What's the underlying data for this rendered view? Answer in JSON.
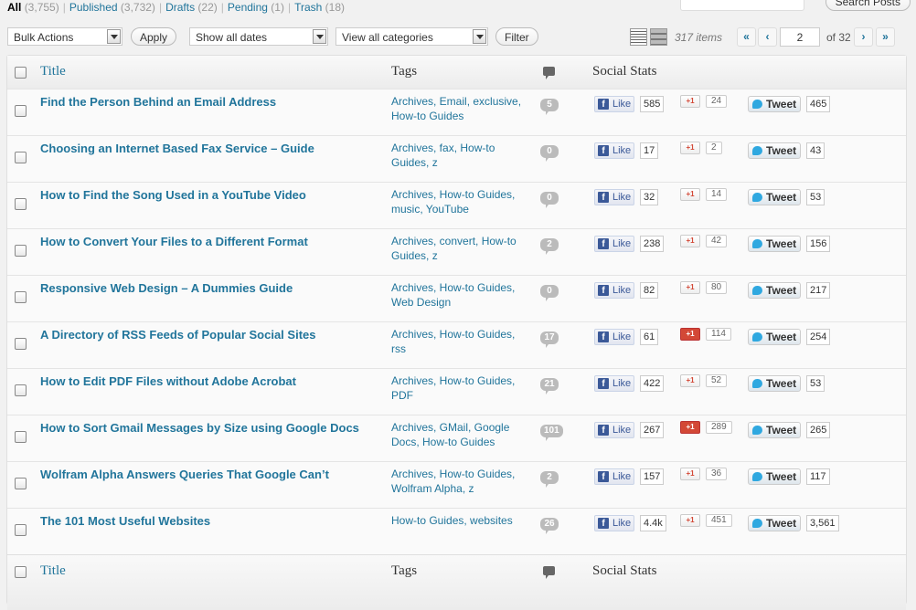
{
  "status_links": [
    {
      "label": "All",
      "count": "(3,755)",
      "current": true
    },
    {
      "label": "Published",
      "count": "(3,732)",
      "current": false
    },
    {
      "label": "Drafts",
      "count": "(22)",
      "current": false
    },
    {
      "label": "Pending",
      "count": "(1)",
      "current": false
    },
    {
      "label": "Trash",
      "count": "(18)",
      "current": false
    }
  ],
  "search_button": "Search Posts",
  "filters": {
    "bulk_actions": "Bulk Actions",
    "apply": "Apply",
    "dates": "Show all dates",
    "categories": "View all categories",
    "filter": "Filter"
  },
  "pagination": {
    "items": "317 items",
    "first": "«",
    "prev": "‹",
    "current_page": "2",
    "of_total": "of 32",
    "next": "›",
    "last": "»"
  },
  "columns": {
    "title": "Title",
    "tags": "Tags",
    "social": "Social Stats"
  },
  "posts": [
    {
      "title": "Find the Person Behind an Email Address",
      "tags": "Archives, Email, exclusive, How-to Guides",
      "comments": "5",
      "fb": "585",
      "gplus": "24",
      "gplus_on": false,
      "tweets": "465"
    },
    {
      "title": "Choosing an Internet Based Fax Service – Guide",
      "tags": "Archives, fax, How-to Guides, z",
      "comments": "0",
      "fb": "17",
      "gplus": "2",
      "gplus_on": false,
      "tweets": "43"
    },
    {
      "title": "How to Find the Song Used in a YouTube Video",
      "tags": "Archives, How-to Guides, music, YouTube",
      "comments": "0",
      "fb": "32",
      "gplus": "14",
      "gplus_on": false,
      "tweets": "53"
    },
    {
      "title": "How to Convert Your Files to a Different Format",
      "tags": "Archives, convert, How-to Guides, z",
      "comments": "2",
      "fb": "238",
      "gplus": "42",
      "gplus_on": false,
      "tweets": "156"
    },
    {
      "title": "Responsive Web Design – A Dummies Guide",
      "tags": "Archives, How-to Guides, Web Design",
      "comments": "0",
      "fb": "82",
      "gplus": "80",
      "gplus_on": false,
      "tweets": "217"
    },
    {
      "title": "A Directory of RSS Feeds of Popular Social Sites",
      "tags": "Archives, How-to Guides, rss",
      "comments": "17",
      "fb": "61",
      "gplus": "114",
      "gplus_on": true,
      "tweets": "254"
    },
    {
      "title": "How to Edit PDF Files without Adobe Acrobat",
      "tags": "Archives, How-to Guides, PDF",
      "comments": "21",
      "fb": "422",
      "gplus": "52",
      "gplus_on": false,
      "tweets": "53"
    },
    {
      "title": "How to Sort Gmail Messages by Size using Google Docs",
      "tags": "Archives, GMail, Google Docs, How-to Guides",
      "comments": "101",
      "fb": "267",
      "gplus": "289",
      "gplus_on": true,
      "tweets": "265"
    },
    {
      "title": "Wolfram Alpha Answers Queries That Google Can’t",
      "tags": "Archives, How-to Guides, Wolfram Alpha, z",
      "comments": "2",
      "fb": "157",
      "gplus": "36",
      "gplus_on": false,
      "tweets": "117"
    },
    {
      "title": "The 101 Most Useful Websites",
      "tags": "How-to Guides, websites",
      "comments": "26",
      "fb": "4.4k",
      "gplus": "451",
      "gplus_on": false,
      "tweets": "3,561"
    }
  ],
  "labels": {
    "like": "Like",
    "plus_one": "+1",
    "tweet": "Tweet",
    "fb_letter": "f"
  },
  "icons": {
    "comment": "comment-bubble-icon",
    "facebook": "facebook-icon",
    "google_plus": "google-plus-icon",
    "twitter": "twitter-bird-icon"
  }
}
